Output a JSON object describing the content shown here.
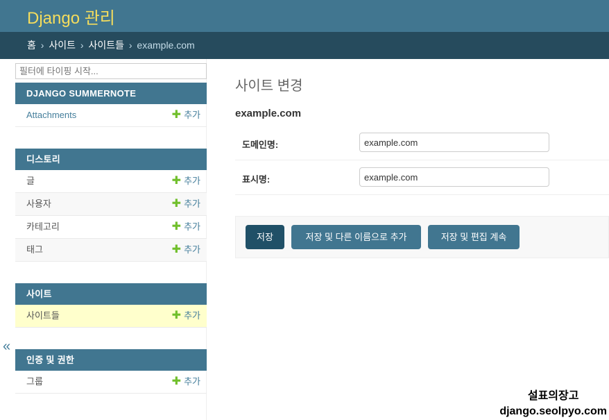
{
  "header": {
    "brand": "Django 관리"
  },
  "breadcrumbs": {
    "home": "홈",
    "app": "사이트",
    "model": "사이트들",
    "current": "example.com",
    "separator": "›"
  },
  "sidebar": {
    "filter_placeholder": "필터에 타이핑 시작...",
    "toggle": "«",
    "add_label": "추가",
    "modules": [
      {
        "caption": "DJANGO SUMMERNOTE",
        "rows": [
          {
            "label": "Attachments"
          }
        ]
      },
      {
        "caption": "디스토리",
        "rows": [
          {
            "label": "글"
          },
          {
            "label": "사용자"
          },
          {
            "label": "카테고리"
          },
          {
            "label": "태그"
          }
        ]
      },
      {
        "caption": "사이트",
        "rows": [
          {
            "label": "사이트들"
          }
        ]
      },
      {
        "caption": "인증 및 권한",
        "rows": [
          {
            "label": "그룹"
          }
        ]
      }
    ]
  },
  "main": {
    "title": "사이트 변경",
    "object_name": "example.com",
    "fields": [
      {
        "label": "도메인명:",
        "value": "example.com"
      },
      {
        "label": "표시명:",
        "value": "example.com"
      }
    ],
    "buttons": {
      "save": "저장",
      "save_as_new": "저장 및 다른 이름으로 추가",
      "save_continue": "저장 및 편집 계속"
    }
  },
  "watermark": {
    "line1": "설표의장고",
    "line2": "django.seolpyo.com"
  },
  "colors": {
    "header": "#417690",
    "breadcrumbs": "#264b5d",
    "brand": "#f5dd5d",
    "add_plus": "#70bf2b",
    "current_row": "#ffffcc"
  }
}
